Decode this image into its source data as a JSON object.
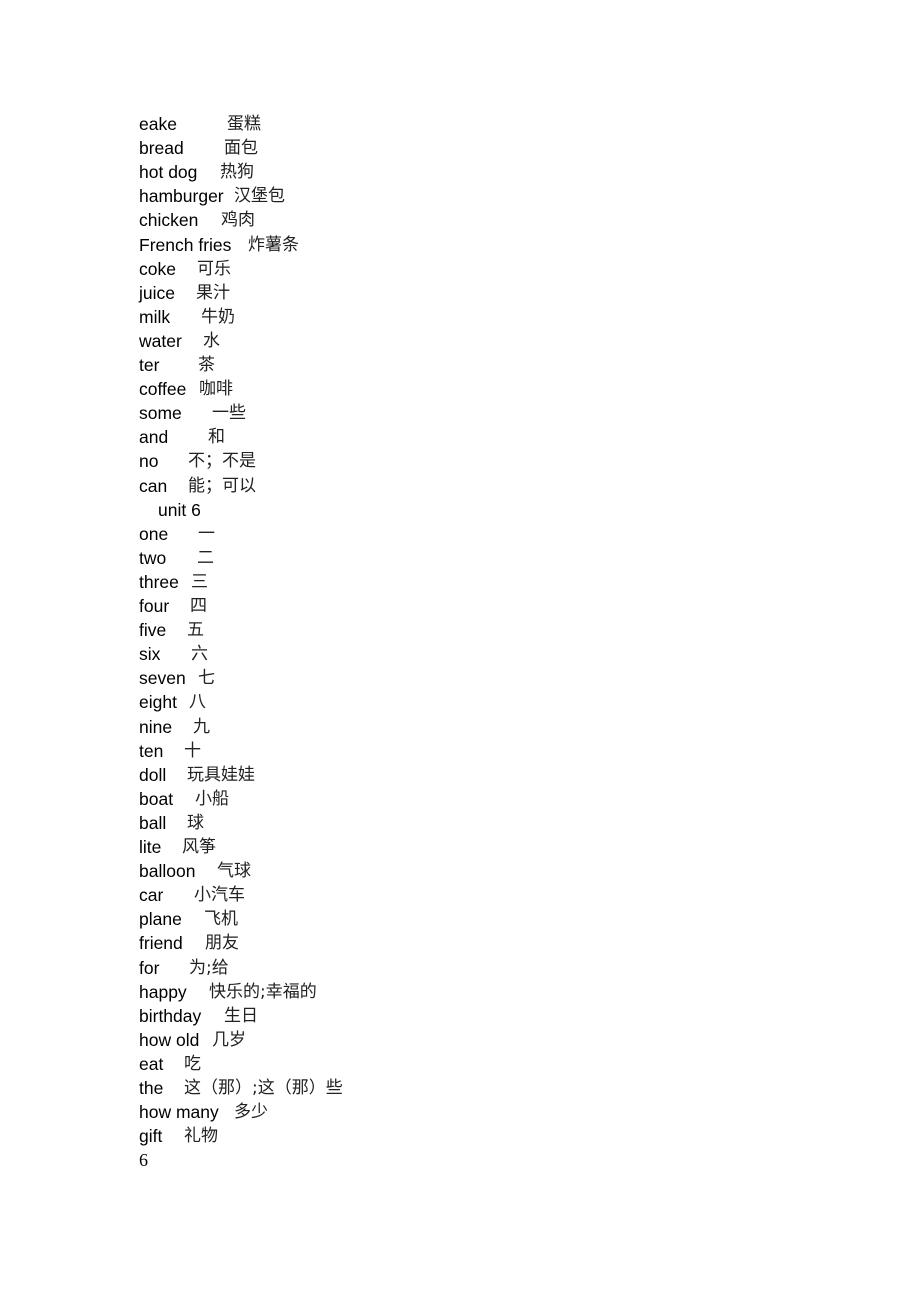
{
  "vocab_a": [
    {
      "en": "eake",
      "zh": "蛋糕"
    },
    {
      "en": "bread",
      "zh": "面包"
    },
    {
      "en": "hot dog",
      "zh": "热狗"
    },
    {
      "en": "hamburger",
      "zh": "汉堡包"
    },
    {
      "en": "chicken",
      "zh": "鸡肉"
    },
    {
      "en": "French fries",
      "zh": "炸薯条"
    },
    {
      "en": "coke",
      "zh": "可乐"
    },
    {
      "en": "juice",
      "zh": "果汁"
    },
    {
      "en": "milk",
      "zh": "牛奶"
    },
    {
      "en": "water",
      "zh": "水"
    },
    {
      "en": "ter",
      "zh": "茶"
    },
    {
      "en": "coffee",
      "zh": "咖啡"
    },
    {
      "en": "some",
      "zh": "一些"
    },
    {
      "en": "and",
      "zh": "和"
    },
    {
      "en": "no",
      "zh": "不；不是"
    },
    {
      "en": "can",
      "zh": "能；可以"
    }
  ],
  "unit_heading": "unit 6",
  "vocab_b": [
    {
      "en": "one",
      "zh": "一"
    },
    {
      "en": "two",
      "zh": "二"
    },
    {
      "en": "three",
      "zh": "三"
    },
    {
      "en": "four",
      "zh": "四"
    },
    {
      "en": "five",
      "zh": "五"
    },
    {
      "en": "six",
      "zh": "六"
    },
    {
      "en": "seven",
      "zh": "七"
    },
    {
      "en": "eight",
      "zh": "八"
    },
    {
      "en": "nine",
      "zh": "九"
    },
    {
      "en": "ten",
      "zh": "十"
    },
    {
      "en": "doll",
      "zh": "玩具娃娃"
    },
    {
      "en": "boat",
      "zh": "小船"
    },
    {
      "en": "ball",
      "zh": "球"
    },
    {
      "en": "lite",
      "zh": "风筝"
    },
    {
      "en": "balloon",
      "zh": "气球"
    },
    {
      "en": "car",
      "zh": "小汽车"
    },
    {
      "en": "plane",
      "zh": "飞机"
    },
    {
      "en": "friend",
      "zh": "朋友"
    },
    {
      "en": "for",
      "zh": "为;给"
    },
    {
      "en": "happy",
      "zh": "快乐的;幸福的"
    },
    {
      "en": "birthday",
      "zh": "生日"
    },
    {
      "en": "how old",
      "zh": "几岁"
    },
    {
      "en": "eat",
      "zh": "吃"
    },
    {
      "en": "the",
      "zh": "这（那）;这（那）些"
    },
    {
      "en": "how many",
      "zh": "多少"
    },
    {
      "en": "gift",
      "zh": "礼物"
    }
  ],
  "page_number": "6"
}
